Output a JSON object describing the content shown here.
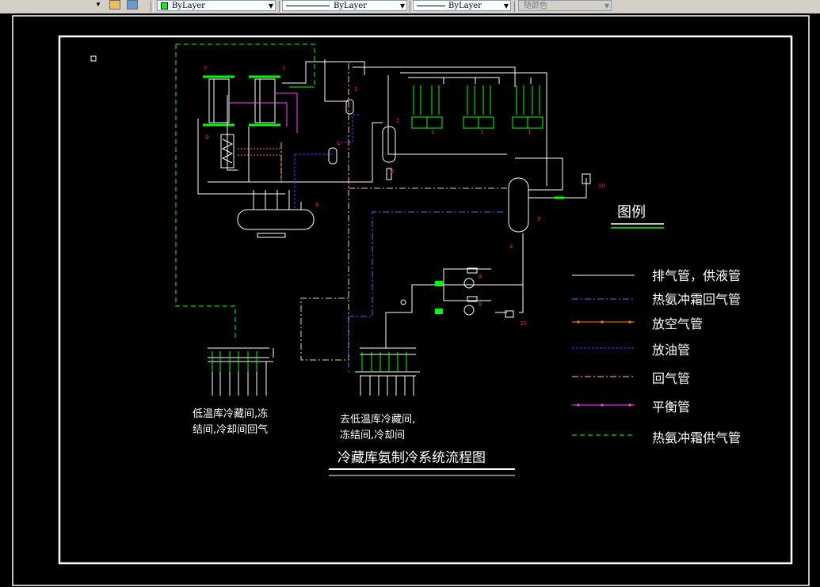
{
  "toolbar": {
    "color_label": "ByLayer",
    "linetype_label": "ByLayer",
    "lineweight_label": "ByLayer",
    "plotstyle_label": "随颜色",
    "accent_green": "#00ff00"
  },
  "drawing": {
    "title": "冷藏库氨制冷系统流程图",
    "legend_title": "图例",
    "legend": [
      {
        "label": "排气管，供液管",
        "color": "#ffffff",
        "style": "solid"
      },
      {
        "label": "热氨冲霜回气管",
        "color": "#6060ff",
        "style": "dashdot"
      },
      {
        "label": "放空气管",
        "color": "#ff8000",
        "style": "dotted-nodes"
      },
      {
        "label": "放油管",
        "color": "#4040ff",
        "style": "dashed"
      },
      {
        "label": "回气管",
        "color": "#ffcc80",
        "style": "dashdot"
      },
      {
        "label": "平衡管",
        "color": "#ff40ff",
        "style": "solid-nodes"
      },
      {
        "label": "热氨冲霜供气管",
        "color": "#00ff00",
        "style": "dashed"
      }
    ],
    "left_note_line1": "低温库冷藏间,冻",
    "left_note_line2": "结间,冷却间回气",
    "center_note_line1": "去低温库冷藏间,",
    "center_note_line2": "冻结间,冷却间",
    "numbers": {
      "n7a": "7",
      "n7b": "7",
      "n5": "5",
      "n2": "2",
      "n9": "9",
      "n4a": "4",
      "n4b": "4",
      "n6": "6",
      "n1a": "1",
      "n1b": "1",
      "n1c": "1",
      "n10a": "10",
      "n3": "3",
      "n8a": "8",
      "n8b": "8",
      "n10b": "10",
      "n4c": "4"
    }
  }
}
